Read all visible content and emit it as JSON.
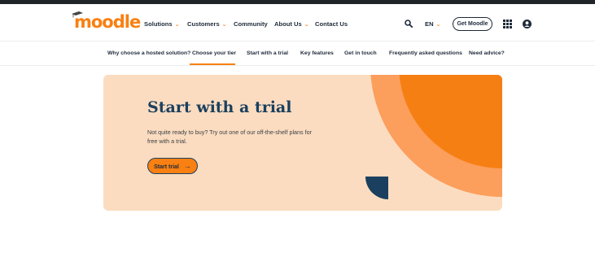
{
  "brand": {
    "name": "moodle",
    "accent": "#f98012",
    "navy": "#1b3f5e",
    "hero_bg": "#fbdcc0",
    "dark": "#1e2a3a"
  },
  "main_nav": {
    "items": [
      {
        "label": "Solutions",
        "has_dropdown": true
      },
      {
        "label": "Customers",
        "has_dropdown": true
      },
      {
        "label": "Community",
        "has_dropdown": false
      },
      {
        "label": "About Us",
        "has_dropdown": true
      },
      {
        "label": "Contact Us",
        "has_dropdown": false
      }
    ],
    "chevron": "⌄",
    "language": "EN",
    "cta": "Get Moodle",
    "icons": [
      "search-icon",
      "grid-apps-icon",
      "user-account-icon"
    ]
  },
  "sub_nav": {
    "items": [
      "Why choose a hosted solution?",
      "Choose your tier",
      "Start with a trial",
      "Key features",
      "Get in touch",
      "Frequently asked questions",
      "Need advice?"
    ],
    "active_index": 1
  },
  "hero": {
    "title": "Start with a trial",
    "body": "Not quite ready to buy? Try out one of our off-the-shelf plans for free with a trial.",
    "button_label": "Start trial",
    "button_icon": "arrow-right-icon",
    "arrow": "→"
  }
}
